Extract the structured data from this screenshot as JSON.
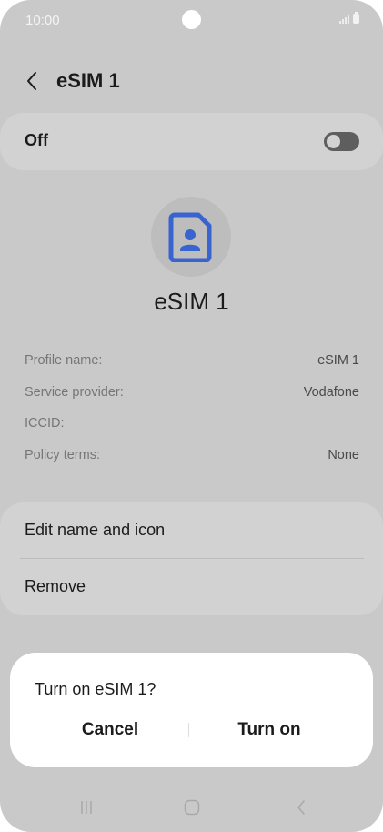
{
  "status_bar": {
    "time": "10:00"
  },
  "header": {
    "title": "eSIM 1"
  },
  "toggle_card": {
    "label": "Off",
    "enabled": false
  },
  "profile": {
    "name": "eSIM 1",
    "icon": "sim-card-person-icon",
    "icon_color": "#3764cf"
  },
  "details": [
    {
      "label": "Profile name:",
      "value": "eSIM 1"
    },
    {
      "label": "Service provider:",
      "value": "Vodafone"
    },
    {
      "label": "ICCID:",
      "value": ""
    },
    {
      "label": "Policy terms:",
      "value": "None"
    }
  ],
  "actions": [
    {
      "label": "Edit name and icon"
    },
    {
      "label": "Remove"
    }
  ],
  "dialog": {
    "title": "Turn on eSIM 1?",
    "cancel_label": "Cancel",
    "confirm_label": "Turn on"
  },
  "nav": {
    "recents": "recents-icon",
    "home": "home-icon",
    "back": "back-icon"
  }
}
